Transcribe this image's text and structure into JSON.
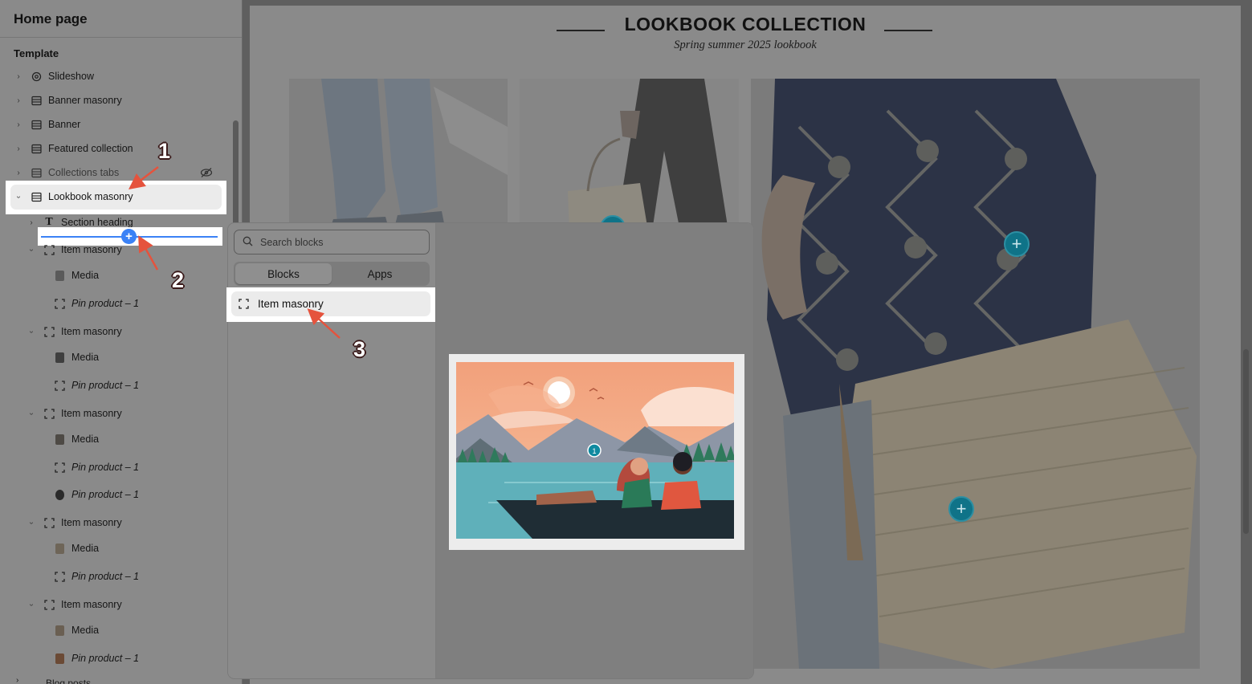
{
  "sidebar": {
    "title": "Home page",
    "section_label": "Template",
    "items": [
      {
        "label": "Slideshow",
        "icon": "slideshow-icon"
      },
      {
        "label": "Banner masonry",
        "icon": "section-icon"
      },
      {
        "label": "Banner",
        "icon": "section-icon"
      },
      {
        "label": "Featured collection",
        "icon": "section-icon"
      },
      {
        "label": "Collections tabs",
        "icon": "section-icon",
        "hidden": true
      },
      {
        "label": "Lookbook masonry",
        "icon": "section-icon",
        "expanded": true,
        "selected": true
      }
    ],
    "children": {
      "section_heading": "Section heading",
      "groups": [
        {
          "label": "Item masonry",
          "media": "Media",
          "pins": [
            "Pin product – 1"
          ]
        },
        {
          "label": "Item masonry",
          "media": "Media",
          "pins": [
            "Pin product – 1"
          ]
        },
        {
          "label": "Item masonry",
          "media": "Media",
          "pins": [
            "Pin product – 1",
            "Pin product – 1"
          ]
        },
        {
          "label": "Item masonry",
          "media": "Media",
          "pins": [
            "Pin product – 1"
          ]
        },
        {
          "label": "Item masonry",
          "media": "Media",
          "pins": [
            "Pin product – 1"
          ]
        }
      ]
    },
    "cut_off_item": "Blog posts"
  },
  "preview": {
    "title": "LOOKBOOK COLLECTION",
    "subtitle": "Spring summer 2025 lookbook"
  },
  "picker": {
    "search_placeholder": "Search blocks",
    "tabs": [
      "Blocks",
      "Apps"
    ],
    "active_tab": "Blocks",
    "blocks": [
      "Item masonry"
    ],
    "preview_hotspot_label": "1"
  },
  "annotations": [
    "1",
    "2",
    "3"
  ],
  "colors": {
    "accent_blue": "#3b82f6",
    "annotation_arrow": "#e5533d",
    "hotspot_teal": "#0f7388"
  }
}
